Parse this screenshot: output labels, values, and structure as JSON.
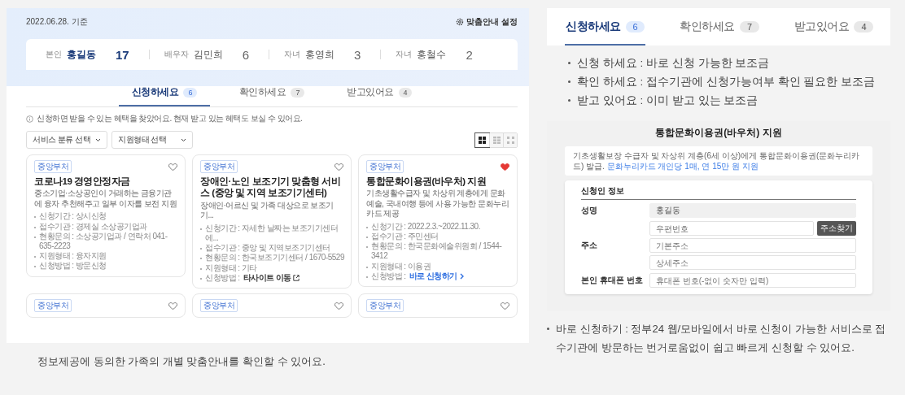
{
  "overview": {
    "date": "2022.06.28. 기준",
    "settings_link": "맞춤안내 설정",
    "members": [
      {
        "relation": "본인",
        "name": "홍길동",
        "count": "17",
        "selected": true
      },
      {
        "relation": "배우자",
        "name": "김민희",
        "count": "6",
        "selected": false
      },
      {
        "relation": "자녀",
        "name": "홍영희",
        "count": "3",
        "selected": false
      },
      {
        "relation": "자녀",
        "name": "홍철수",
        "count": "2",
        "selected": false
      }
    ],
    "tabs": [
      {
        "label": "신청하세요",
        "count": "6",
        "selected": true
      },
      {
        "label": "확인하세요",
        "count": "7",
        "selected": false
      },
      {
        "label": "받고있어요",
        "count": "4",
        "selected": false
      }
    ],
    "notice": "신청하면 받을 수 있는 혜택을 찾았어요. 현재 받고 있는 혜택도 보실 수 있어요.",
    "filters": [
      {
        "label": "서비스 분류 선택"
      },
      {
        "label": "지원형태 선택"
      }
    ],
    "view_options": [
      {
        "kind": "grid-large",
        "selected": true
      },
      {
        "kind": "grid-medium",
        "selected": false
      },
      {
        "kind": "grid-small",
        "selected": false
      }
    ],
    "cards": [
      {
        "tag": "중앙부처",
        "favorite": false,
        "title": "코로나19 경영안정자금",
        "description": "중소기업·소상공인이 거래하는 금융기관에 융자 추천해주고 일부 이자를 보전 지원",
        "details": [
          {
            "kind": "text",
            "text": "신청기간 : 상시신청"
          },
          {
            "kind": "text",
            "text": "접수기관 : 경제실 소상공기업과"
          },
          {
            "kind": "text",
            "text": "현황문의 : 소상공기업과 / 연락처 041-635-2223"
          },
          {
            "kind": "text",
            "text": "지원형태 : 융자지원"
          },
          {
            "kind": "text",
            "text": "신청방법 : 방문신청"
          }
        ]
      },
      {
        "tag": "중앙부처",
        "favorite": false,
        "title": "장애인·노인 보조기기 맞춤형 서비스 (중앙 및 지역 보조기기센터)",
        "description": "장애인·어르신 및 가족 대상으로 보조기기...",
        "details": [
          {
            "kind": "text",
            "text": "신청기간 : 자세한 날짜는 보조기기센터에..."
          },
          {
            "kind": "text",
            "text": "접수기관 : 중앙 및 지역보조기기센터"
          },
          {
            "kind": "text",
            "text": "현황문의 : 한국보조기기센터 / 1670-5529"
          },
          {
            "kind": "text",
            "text": "지원형태 : 기타"
          },
          {
            "kind": "external",
            "label": "신청방법 :",
            "value": "타사이트 이동"
          }
        ]
      },
      {
        "tag": "중앙부처",
        "favorite": true,
        "title": "통합문화이용권(바우처) 지원",
        "description": "기초생활수급자 및 차상위 계층에게 문화예술, 국내여행 등에 사용 가능한 문화누리카드 제공",
        "details": [
          {
            "kind": "text",
            "text": "신청기간 : 2022.2.3.~2022.11.30."
          },
          {
            "kind": "text",
            "text": "접수기관 : 주민센터"
          },
          {
            "kind": "text",
            "text": "현황문의 : 한국문화예술위원회 / 1544-3412"
          },
          {
            "kind": "text",
            "text": "지원형태 : 이용권"
          },
          {
            "kind": "apply",
            "label": "신청방법 :",
            "value": "바로 신청하기"
          }
        ]
      },
      {
        "tag": "중앙부처",
        "favorite": false
      },
      {
        "tag": "중앙부처",
        "favorite": false
      },
      {
        "tag": "중앙부처",
        "favorite": false
      }
    ],
    "caption": "정보제공에 동의한 가족의 개별 맞춤안내를 확인할 수 있어요."
  },
  "tab_detail": {
    "tabs": [
      {
        "label": "신청하세요",
        "count": "6",
        "selected": true
      },
      {
        "label": "확인하세요",
        "count": "7",
        "selected": false
      },
      {
        "label": "받고있어요",
        "count": "4",
        "selected": false
      }
    ],
    "bullets": [
      "신청 하세요 : 바로 신청 가능한 보조금",
      "확인 하세요 : 접수기관에 신청가능여부 확인 필요한 보조금",
      "받고 있어요 : 이미 받고 있는 보조금"
    ]
  },
  "apply_form": {
    "title": "통합문화이용권(바우처) 지원",
    "intro": "기초생활보장 수급자 및 차상위 계층(6세 이상)에게 통합문화이용권(문화누리카드) 발급.",
    "intro_link": "문화누리카드 개인당 1매, 연 15만 원 지원",
    "section_title": "신청인 정보",
    "fields": [
      {
        "kind": "readonly",
        "label": "성명",
        "value": "홍길동"
      },
      {
        "kind": "address",
        "label": "주소",
        "placeholders": [
          "우편번호",
          "기본주소",
          "상세주소"
        ],
        "button": "주소찾기"
      },
      {
        "kind": "text",
        "label": "본인 휴대폰 번호",
        "placeholder": "휴대폰 번호(-없이 숫자만 입력)"
      }
    ],
    "note": "바로 신청하기 : 정부24 웹/모바일에서 바로 신청이 가능한 서비스로 접수기관에 방문하는 번거로움없이 쉽고 빠르게 신청할 수 있어요."
  }
}
